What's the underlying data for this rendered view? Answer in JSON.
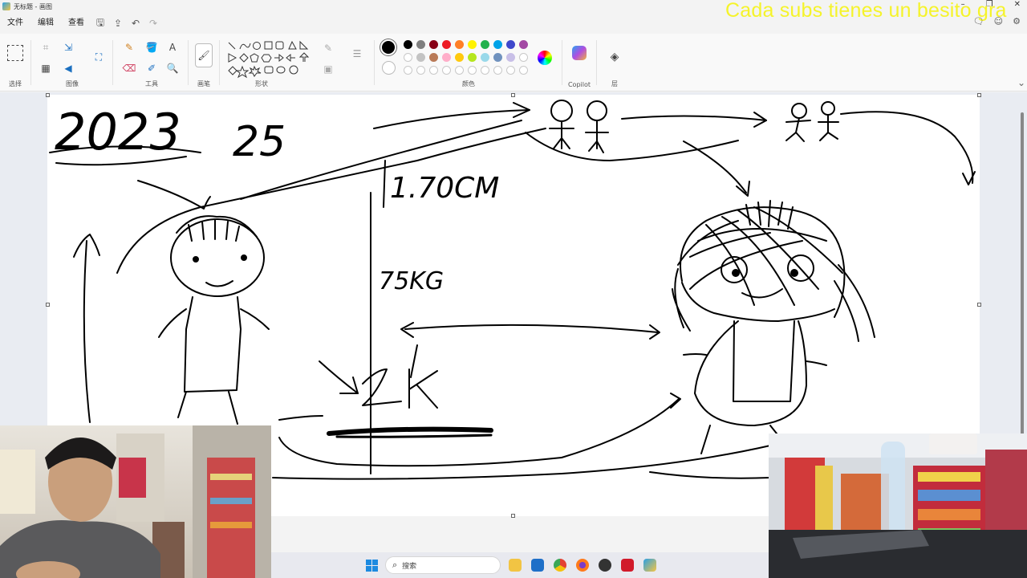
{
  "window": {
    "title": "无标题 - 画图"
  },
  "overlay": {
    "text": "Cada subs tienes un besito gra"
  },
  "menu": {
    "file": "文件",
    "edit": "编辑",
    "view": "查看"
  },
  "ribbon": {
    "groups": {
      "selection": "选择",
      "image": "图像",
      "tools": "工具",
      "brushes": "画笔",
      "shapes": "形状",
      "colors": "颜色",
      "copilot": "Copilot",
      "layers": "层"
    },
    "primary_color": "#000000",
    "palette_row1": [
      "#000000",
      "#7f7f7f",
      "#880015",
      "#ed1c24",
      "#ff7f27",
      "#fff200",
      "#22b14c",
      "#00a2e8",
      "#3f48cc",
      "#a349a4"
    ],
    "palette_row2": [
      "#ffffff",
      "#c3c3c3",
      "#b97a57",
      "#ffaec9",
      "#ffc90e",
      "#b5e61d",
      "#99d9ea",
      "#7092be",
      "#c8bfe7",
      "#ffffff"
    ]
  },
  "canvas": {
    "sketch_text": {
      "year": "2023",
      "number": "25",
      "height": "1.70CM",
      "weight": "75KG",
      "amount": "2K"
    }
  },
  "taskbar": {
    "search_placeholder": "搜索"
  }
}
